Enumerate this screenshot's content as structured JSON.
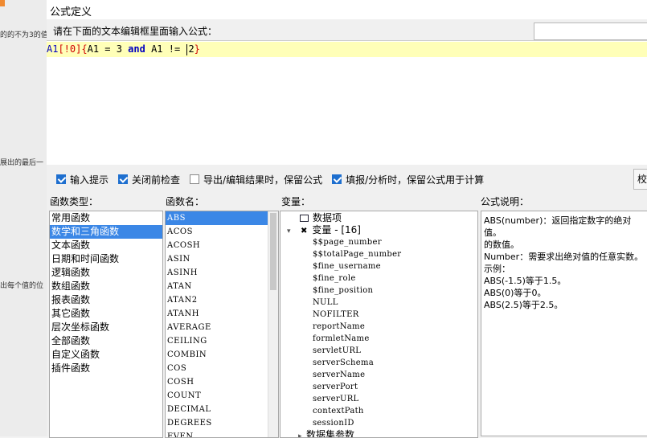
{
  "background": {
    "fragments": [
      "的的不为3的值",
      "展出的最后一",
      "出每个值的位"
    ]
  },
  "dialog": {
    "title": "公式定义",
    "prompt": "请在下面的文本编辑框里面输入公式：",
    "top_field_value": ""
  },
  "editor": {
    "tokens": [
      {
        "text": "A1",
        "kind": "id"
      },
      {
        "text": "[!0]",
        "kind": "br"
      },
      {
        "text": "{",
        "kind": "br"
      },
      {
        "text": "A1 = 3 ",
        "kind": "num"
      },
      {
        "text": "and",
        "kind": "kw"
      },
      {
        "text": " A1 != ",
        "kind": "num"
      },
      {
        "text": "2",
        "kind": "num"
      },
      {
        "text": "}",
        "kind": "br"
      }
    ]
  },
  "options": [
    {
      "label": "输入提示",
      "checked": true
    },
    {
      "label": "关闭前检查",
      "checked": true
    },
    {
      "label": "导出/编辑结果时，保留公式",
      "checked": false
    },
    {
      "label": "填报/分析时，保留公式用于计算",
      "checked": true
    }
  ],
  "end_button": {
    "label": "校"
  },
  "headers": {
    "categories": "函数类型：",
    "functions": "函数名：",
    "variables": "变量：",
    "description": "公式说明："
  },
  "categories": {
    "selected_index": 1,
    "items": [
      "常用函数",
      "数学和三角函数",
      "文本函数",
      "日期和时间函数",
      "逻辑函数",
      "数组函数",
      "报表函数",
      "其它函数",
      "层次坐标函数",
      "全部函数",
      "自定义函数",
      "插件函数"
    ]
  },
  "functions": {
    "selected_index": 0,
    "items": [
      "ABS",
      "ACOS",
      "ACOSH",
      "ASIN",
      "ASINH",
      "ATAN",
      "ATAN2",
      "ATANH",
      "AVERAGE",
      "CEILING",
      "COMBIN",
      "COS",
      "COSH",
      "COUNT",
      "DECIMAL",
      "DEGREES",
      "EVEN"
    ]
  },
  "variables": {
    "group_data_item": "数据项",
    "group_variables": "变量 - [16]",
    "group_dataset_params": "数据集参数",
    "items": [
      "$$page_number",
      "$$totalPage_number",
      "$fine_username",
      "$fine_role",
      "$fine_position",
      "NULL",
      "NOFILTER",
      "reportName",
      "formletName",
      "servletURL",
      "serverSchema",
      "serverName",
      "serverPort",
      "serverURL",
      "contextPath",
      "sessionID"
    ]
  },
  "description": {
    "text": "ABS(number)：返回指定数字的绝对值。\n的数值。\nNumber：需要求出绝对值的任意实数。\n示例：\nABS(-1.5)等于1.5。\nABS(0)等于0。\nABS(2.5)等于2.5。"
  }
}
